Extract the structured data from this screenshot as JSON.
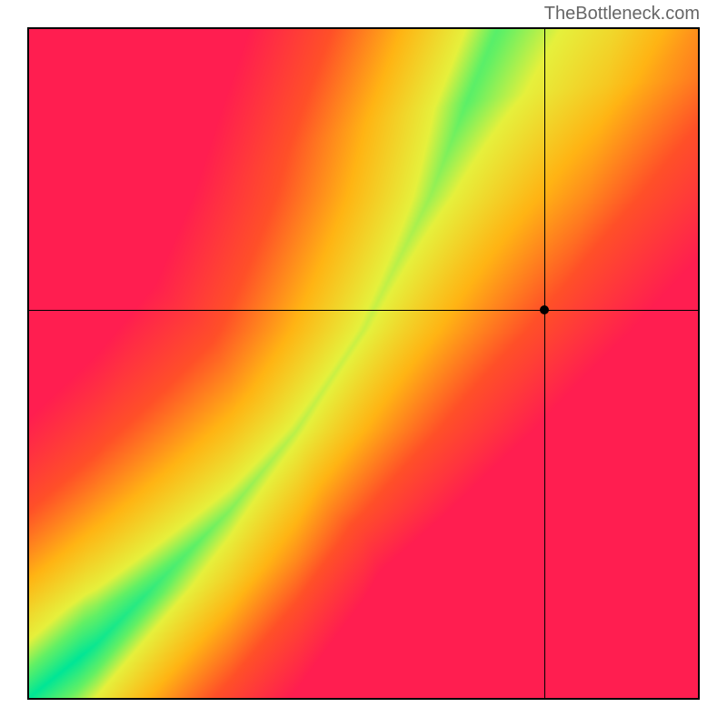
{
  "watermark": "TheBottleneck.com",
  "chart_data": {
    "type": "heatmap",
    "title": "",
    "xlabel": "",
    "ylabel": "",
    "xlim": [
      0,
      100
    ],
    "ylim": [
      0,
      100
    ],
    "colormap": "red-yellow-green",
    "colormap_description": "Red (low compatibility) through orange, yellow, to green (optimal compatibility)",
    "optimal_ridge": {
      "description": "Green curved band representing optimal balance, starting bottom-left and curving upward to top-center-right",
      "approximate_path_x": [
        0,
        10,
        20,
        30,
        40,
        50,
        55,
        60,
        65,
        70
      ],
      "approximate_path_y": [
        0,
        8,
        18,
        28,
        40,
        55,
        65,
        75,
        88,
        100
      ]
    },
    "crosshair": {
      "x": 77,
      "y": 58
    },
    "marker": {
      "x": 77,
      "y": 58
    }
  }
}
